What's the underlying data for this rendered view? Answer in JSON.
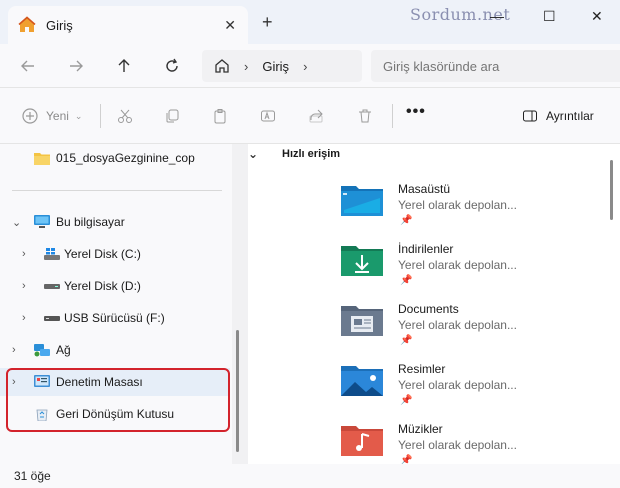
{
  "window": {
    "tab_label": "Giriş",
    "tab_close": "✕",
    "new_tab": "+",
    "watermark": "Sordum.net",
    "minimize": "—",
    "maximize": "☐",
    "close": "✕"
  },
  "address": {
    "breadcrumb": [
      "Giriş"
    ],
    "search_placeholder": "Giriş klasöründe ara"
  },
  "toolbar": {
    "new_label": "Yeni",
    "more": "•••",
    "details_label": "Ayrıntılar"
  },
  "sidebar": {
    "items": [
      {
        "label": "015_dosyaGezginine_cop",
        "icon": "folder-icon"
      },
      {
        "label": "Bu bilgisayar",
        "icon": "computer-icon"
      },
      {
        "label": "Yerel Disk (C:)",
        "icon": "windows-drive-icon"
      },
      {
        "label": "Yerel Disk (D:)",
        "icon": "drive-icon"
      },
      {
        "label": "USB Sürücüsü (F:)",
        "icon": "usb-drive-icon"
      },
      {
        "label": "Ağ",
        "icon": "network-icon"
      },
      {
        "label": "Denetim Masası",
        "icon": "control-panel-icon"
      },
      {
        "label": "Geri Dönüşüm Kutusu",
        "icon": "recycle-bin-icon"
      }
    ]
  },
  "main": {
    "section_title": "Hızlı erişim",
    "items": [
      {
        "name": "Masaüstü",
        "sub": "Yerel olarak depolan...",
        "color": "#1e90d6"
      },
      {
        "name": "İndirilenler",
        "sub": "Yerel olarak depolan...",
        "color": "#1a9a6c"
      },
      {
        "name": "Documents",
        "sub": "Yerel olarak depolan...",
        "color": "#6b7a8f"
      },
      {
        "name": "Resimler",
        "sub": "Yerel olarak depolan...",
        "color": "#2b87d9"
      },
      {
        "name": "Müzikler",
        "sub": "Yerel olarak depolan...",
        "color": "#e35b4a"
      }
    ]
  },
  "status": {
    "text": "31 öğe"
  },
  "colors": {
    "accent": "#0067c0",
    "highlight_border": "#d3232c"
  }
}
